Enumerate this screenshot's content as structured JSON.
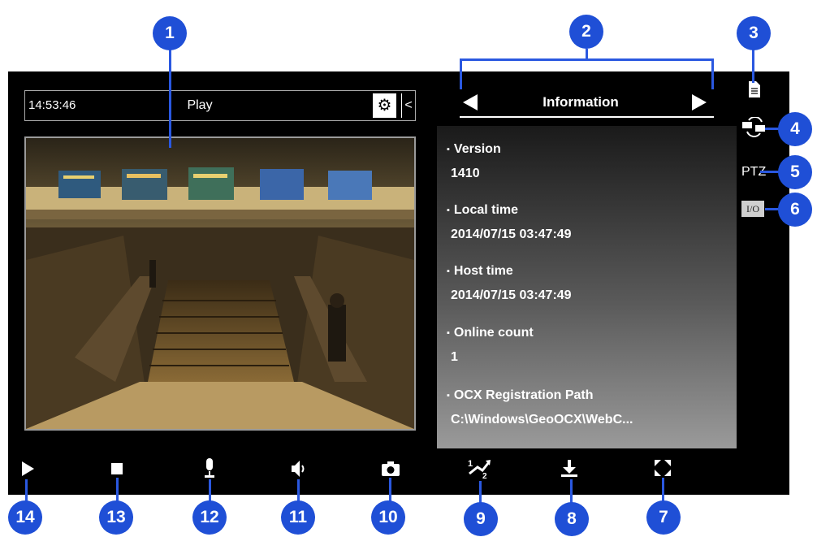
{
  "status_bar": {
    "time": "14:53:46",
    "mode": "Play"
  },
  "panel": {
    "title": "Information",
    "items": [
      {
        "label": "Version",
        "value": "1410"
      },
      {
        "label": "Local time",
        "value": "2014/07/15 03:47:49"
      },
      {
        "label": "Host time",
        "value": "2014/07/15 03:47:49"
      },
      {
        "label": "Online count",
        "value": "1"
      },
      {
        "label": "OCX Registration Path",
        "value": "C:\\Windows\\GeoOCX\\WebC..."
      }
    ]
  },
  "side": {
    "ptz_label": "PTZ",
    "io_label": "I/O"
  },
  "callouts": [
    "1",
    "2",
    "3",
    "4",
    "5",
    "6",
    "7",
    "8",
    "9",
    "10",
    "11",
    "12",
    "13",
    "14"
  ],
  "icons": [
    "gear-icon",
    "chevron-left-icon",
    "document-icon",
    "camera-link-icon",
    "play-icon",
    "stop-icon",
    "microphone-icon",
    "speaker-icon",
    "snapshot-icon",
    "speed-icon",
    "download-icon",
    "fullscreen-icon"
  ],
  "colors": {
    "callout": "#1f4fd6",
    "ui_background": "#000000"
  }
}
